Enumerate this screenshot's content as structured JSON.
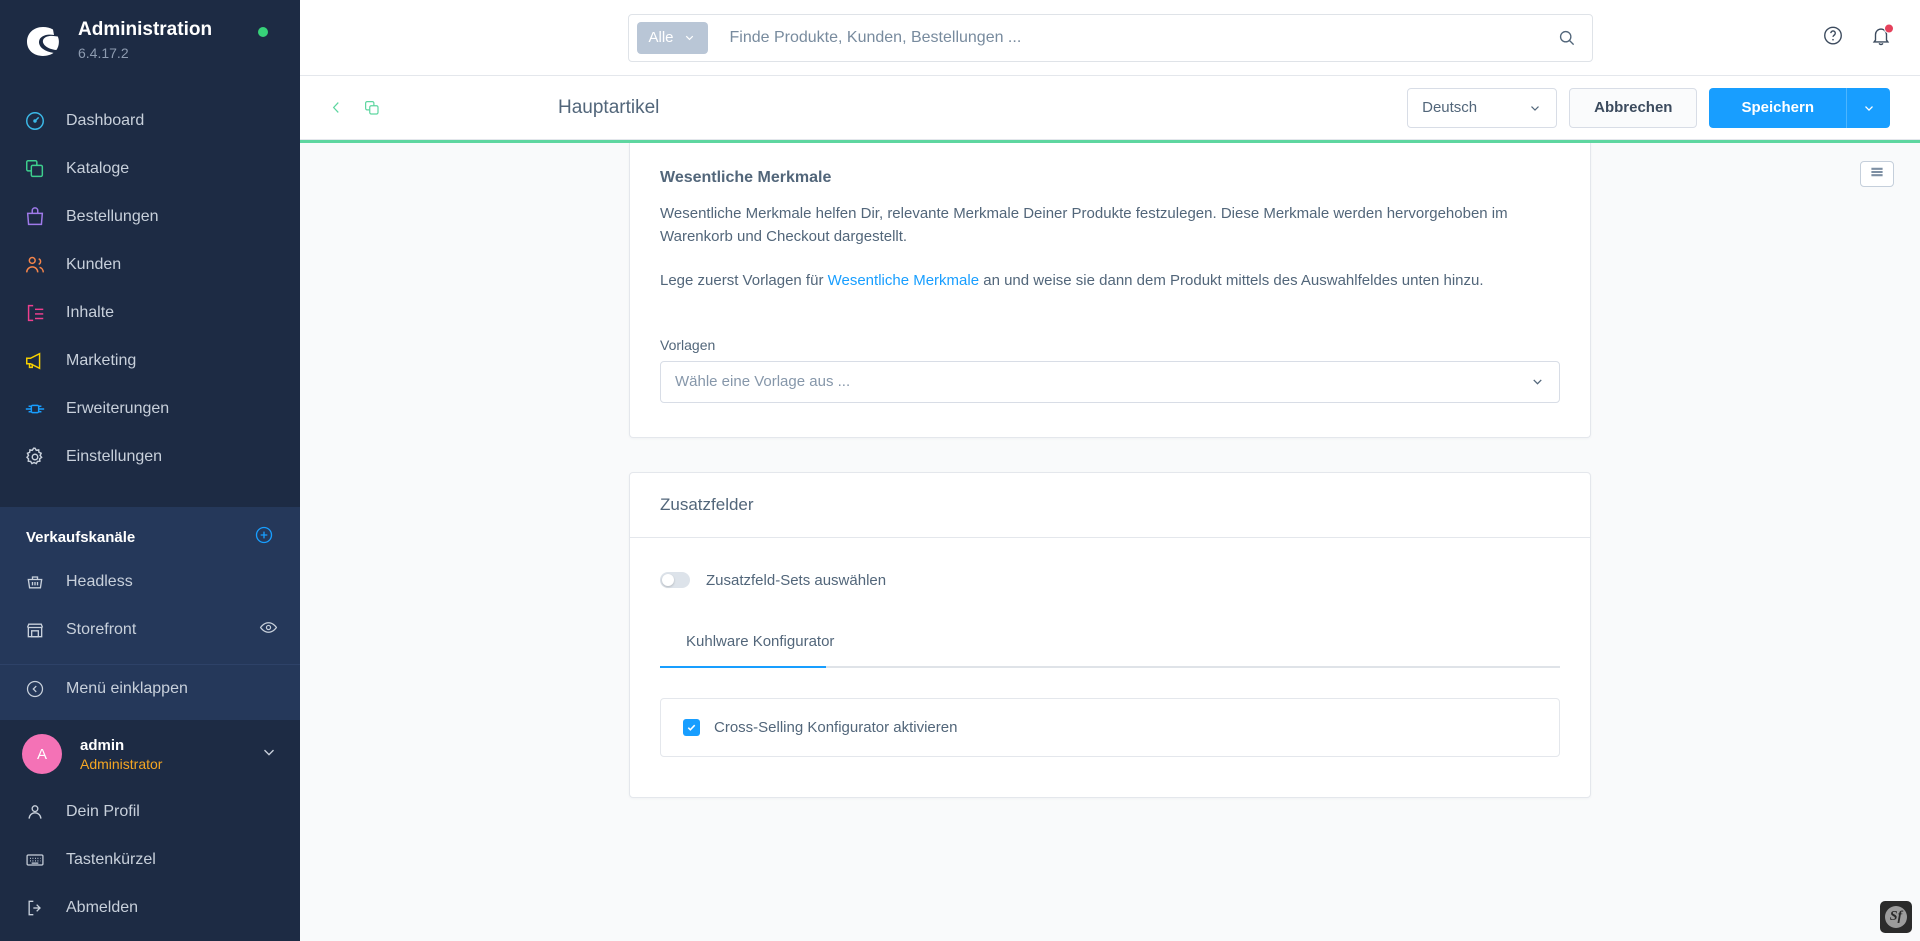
{
  "sidebar": {
    "brand": {
      "title": "Administration",
      "version": "6.4.17.2",
      "status_color": "#37d279"
    },
    "nav": [
      {
        "label": "Dashboard",
        "icon": "speedometer-icon",
        "color": "#3bb9e8"
      },
      {
        "label": "Kataloge",
        "icon": "catalog-icon",
        "color": "#3ecf8e"
      },
      {
        "label": "Bestellungen",
        "icon": "bag-icon",
        "color": "#9f7aea"
      },
      {
        "label": "Kunden",
        "icon": "users-icon",
        "color": "#f6854a"
      },
      {
        "label": "Inhalte",
        "icon": "content-icon",
        "color": "#ee3f8e"
      },
      {
        "label": "Marketing",
        "icon": "megaphone-icon",
        "color": "#f7d000"
      },
      {
        "label": "Erweiterungen",
        "icon": "plugin-icon",
        "color": "#189eff"
      },
      {
        "label": "Einstellungen",
        "icon": "gear-icon",
        "color": "#c8d0db"
      }
    ],
    "channels": {
      "title": "Verkaufskanäle",
      "add_label": "plus-circle-icon",
      "items": [
        {
          "label": "Headless",
          "icon": "basket-icon",
          "has_eye": false
        },
        {
          "label": "Storefront",
          "icon": "storefront-icon",
          "has_eye": true
        }
      ],
      "collapse_label": "Menü einklappen"
    },
    "user": {
      "initial": "A",
      "name": "admin",
      "role": "Administrator"
    },
    "bottom": [
      {
        "label": "Dein Profil",
        "icon": "person-icon"
      },
      {
        "label": "Tastenkürzel",
        "icon": "keyboard-icon"
      },
      {
        "label": "Abmelden",
        "icon": "logout-icon"
      }
    ]
  },
  "topbar": {
    "scope_label": "Alle",
    "search_placeholder": "Finde Produkte, Kunden, Bestellungen ...",
    "search_value": "",
    "help_icon": "help-circle-icon",
    "notifications_icon": "bell-icon",
    "has_notification": true
  },
  "pageheader": {
    "back_icon": "chevron-left-icon",
    "duplicate_icon": "duplicate-icon",
    "title": "Hauptartikel",
    "language": "Deutsch",
    "cancel_label": "Abbrechen",
    "save_label": "Speichern",
    "accent_color": "#5ed6a0"
  },
  "content": {
    "side_panel_icon": "list-icon",
    "essential_card": {
      "heading": "Wesentliche Merkmale",
      "paragraph1": "Wesentliche Merkmale helfen Dir, relevante Merkmale Deiner Produkte festzulegen. Diese Merkmale werden hervorgehoben im Warenkorb und Checkout dargestellt.",
      "paragraph2_pre": "Lege zuerst Vorlagen für ",
      "paragraph2_link": "Wesentliche Merkmale",
      "paragraph2_post": " an und weise sie dann dem Produkt mittels des Auswahlfeldes unten hinzu.",
      "field_label": "Vorlagen",
      "field_placeholder": "Wähle eine Vorlage aus ..."
    },
    "custom_fields_card": {
      "title": "Zusatzfelder",
      "switch_label": "Zusatzfeld-Sets auswählen",
      "switch_on": false,
      "tabs": [
        {
          "label": "Kuhlware Konfigurator",
          "active": true
        }
      ],
      "checkbox_label": "Cross-Selling Konfigurator aktivieren",
      "checkbox_checked": true
    }
  },
  "debug": {
    "symfony_label": "Sf"
  }
}
